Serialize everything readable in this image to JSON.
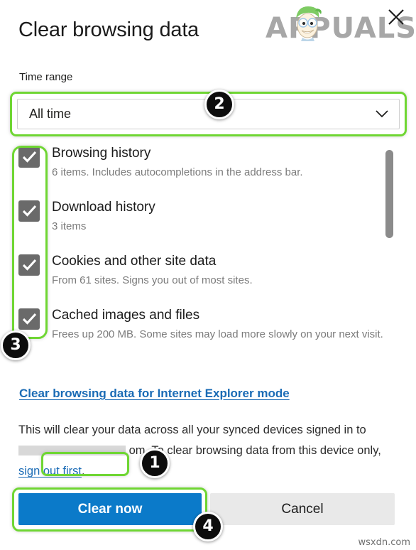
{
  "dialog": {
    "title": "Clear browsing data",
    "close_label": "Close"
  },
  "brand": {
    "logo_text": "APPUALS",
    "watermark": "wsxdn.com"
  },
  "time_range": {
    "label": "Time range",
    "selected": "All time"
  },
  "options": [
    {
      "title": "Browsing history",
      "description": "6 items. Includes autocompletions in the address bar.",
      "checked": true
    },
    {
      "title": "Download history",
      "description": "3 items",
      "checked": true
    },
    {
      "title": "Cookies and other site data",
      "description": "From 61 sites. Signs you out of most sites.",
      "checked": true
    },
    {
      "title": "Cached images and files",
      "description": "Frees up 200 MB. Some sites may load more slowly on your next visit.",
      "checked": true
    }
  ],
  "ie_mode_link": "Clear browsing data for Internet Explorer mode",
  "sync_notice": {
    "part1": "This will clear your data across all your synced devices signed in to",
    "redacted": "",
    "part2": "om. To clear browsing data from this device only,",
    "link": "sign out first",
    "part3": "."
  },
  "buttons": {
    "primary": "Clear now",
    "secondary": "Cancel"
  },
  "badges": [
    {
      "number": "1"
    },
    {
      "number": "2"
    },
    {
      "number": "3"
    },
    {
      "number": "4"
    }
  ],
  "colors": {
    "accent_blue": "#0b7ac9",
    "link_blue": "#1a6bb5",
    "highlight_green": "#6fd633",
    "checkbox_gray": "#6a6a6a",
    "cancel_gray": "#e9e9e9",
    "badge_black": "#0d0d0d"
  }
}
